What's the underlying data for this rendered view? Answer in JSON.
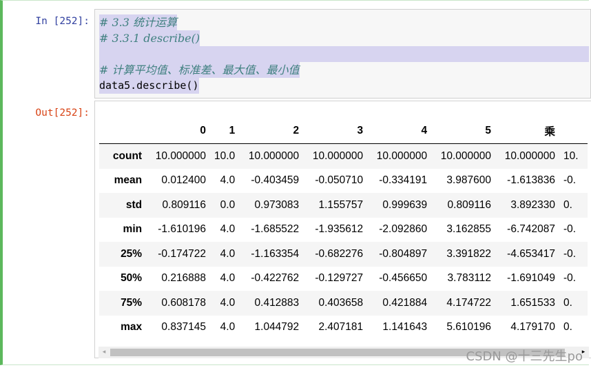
{
  "input_prompt": "In  [252]:",
  "output_prompt": "Out[252]:",
  "code_lines": [
    "# 3.3 统计运算",
    "# 3.3.1 describe()",
    "",
    "# 计算平均值、标准差、最大值、最小值",
    "data5.describe()"
  ],
  "table": {
    "columns": [
      "0",
      "1",
      "2",
      "3",
      "4",
      "5",
      "乘",
      ""
    ],
    "rows": [
      {
        "label": "count",
        "values": [
          "10.000000",
          "10.0",
          "10.000000",
          "10.000000",
          "10.000000",
          "10.000000",
          "10.000000",
          "10."
        ]
      },
      {
        "label": "mean",
        "values": [
          "0.012400",
          "4.0",
          "-0.403459",
          "-0.050710",
          "-0.334191",
          "3.987600",
          "-1.613836",
          "-0."
        ]
      },
      {
        "label": "std",
        "values": [
          "0.809116",
          "0.0",
          "0.973083",
          "1.155757",
          "0.999639",
          "0.809116",
          "3.892330",
          "0."
        ]
      },
      {
        "label": "min",
        "values": [
          "-1.610196",
          "4.0",
          "-1.685522",
          "-1.935612",
          "-2.092860",
          "3.162855",
          "-6.742087",
          "-0."
        ]
      },
      {
        "label": "25%",
        "values": [
          "-0.174722",
          "4.0",
          "-1.163354",
          "-0.682276",
          "-0.804897",
          "3.391822",
          "-4.653417",
          "-0."
        ]
      },
      {
        "label": "50%",
        "values": [
          "0.216888",
          "4.0",
          "-0.422762",
          "-0.129727",
          "-0.456650",
          "3.783112",
          "-1.691049",
          "-0."
        ]
      },
      {
        "label": "75%",
        "values": [
          "0.608178",
          "4.0",
          "0.412883",
          "0.403658",
          "0.421884",
          "4.174722",
          "1.651533",
          "0."
        ]
      },
      {
        "label": "max",
        "values": [
          "0.837145",
          "4.0",
          "1.044792",
          "2.407181",
          "1.141643",
          "5.610196",
          "4.179170",
          "0."
        ]
      }
    ]
  },
  "scrollbar": {
    "left_arrow": "◂",
    "right_arrow": "▸"
  },
  "watermark": "CSDN @十三先生po"
}
